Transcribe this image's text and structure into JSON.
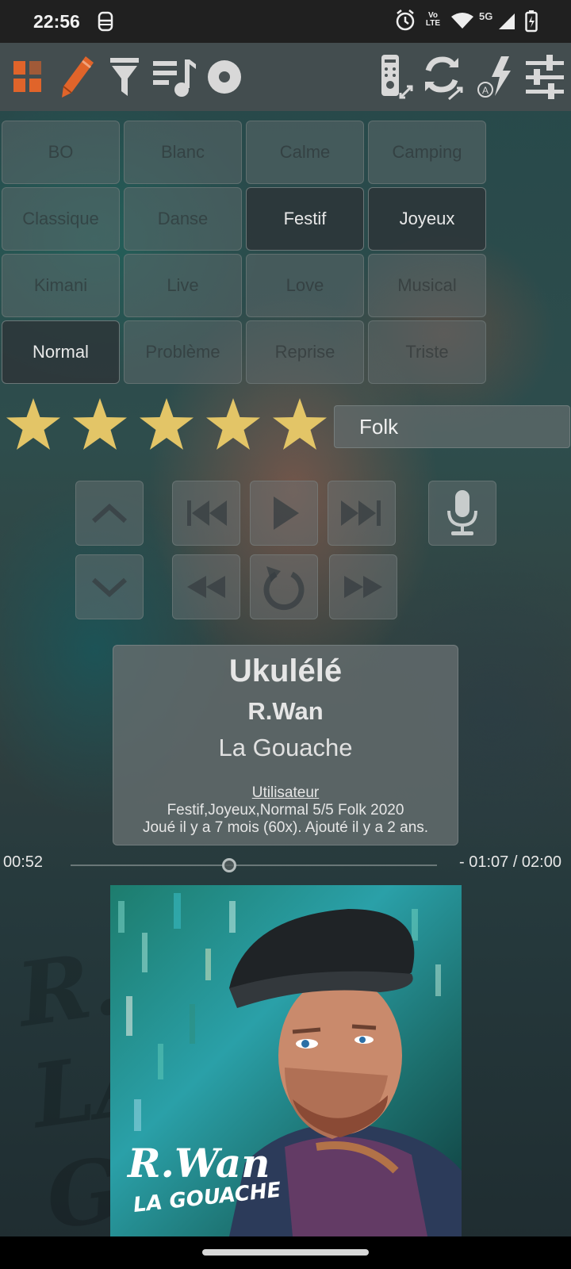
{
  "status_bar": {
    "time": "22:56",
    "network_label": "5G",
    "volte_label": "Vo LTE",
    "icons": [
      "notification-icon",
      "alarm-icon",
      "volte-icon",
      "wifi-icon",
      "cellular-icon",
      "battery-icon"
    ]
  },
  "toolbar": {
    "left_icons": [
      "grid-icon",
      "pencil-icon",
      "filter-icon",
      "playlist-icon",
      "disc-icon"
    ],
    "right_icons": [
      "remote-icon",
      "sync-icon",
      "auto-flash-icon",
      "sliders-icon"
    ],
    "accent_color": "#e0642a"
  },
  "genres": [
    {
      "label": "BO",
      "selected": false
    },
    {
      "label": "Blanc",
      "selected": false
    },
    {
      "label": "Calme",
      "selected": false
    },
    {
      "label": "Camping",
      "selected": false
    },
    {
      "label": "Classique",
      "selected": false
    },
    {
      "label": "Danse",
      "selected": false
    },
    {
      "label": "Festif",
      "selected": true
    },
    {
      "label": "Joyeux",
      "selected": true
    },
    {
      "label": "Kimani",
      "selected": false
    },
    {
      "label": "Live",
      "selected": false
    },
    {
      "label": "Love",
      "selected": false
    },
    {
      "label": "Musical",
      "selected": false
    },
    {
      "label": "Normal",
      "selected": true
    },
    {
      "label": "Problème",
      "selected": false
    },
    {
      "label": "Reprise",
      "selected": false
    },
    {
      "label": "Triste",
      "selected": false
    }
  ],
  "rating": {
    "value": 5,
    "max": 5,
    "star_color": "#e3c567"
  },
  "style_field": {
    "value": "Folk"
  },
  "controls": {
    "row1": [
      "chevron-up-icon",
      "skip-previous-icon",
      "play-icon",
      "skip-next-icon",
      "microphone-icon"
    ],
    "row2": [
      "chevron-down-icon",
      "rewind-icon",
      "replay-icon",
      "fast-forward-icon"
    ]
  },
  "track": {
    "title": "Ukulélé",
    "artist": "R.Wan",
    "album": "La Gouache",
    "user_link": "Utilisateur",
    "tags_line": "Festif,Joyeux,Normal 5/5 Folk 2020",
    "history_line": "Joué il y a 7 mois (60x). Ajouté il y a 2 ans."
  },
  "progress": {
    "elapsed": "00:52",
    "remaining": "- 01:07 / 02:00",
    "fraction": 0.433
  },
  "cover": {
    "logo_text": "R.Wan",
    "logo_sub": "LA GOUACHE",
    "ghost_text": "R.W LA GOU"
  }
}
